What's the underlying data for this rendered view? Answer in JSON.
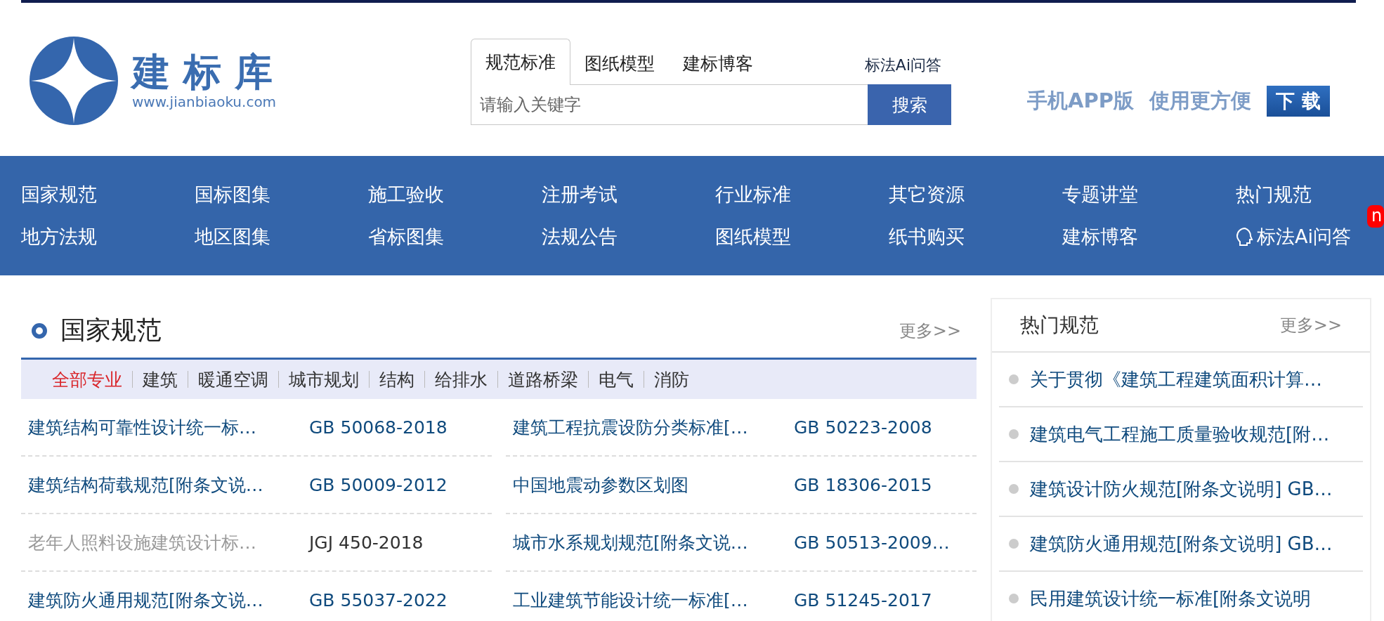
{
  "logo": {
    "name": "建 标 库",
    "url": "www.jianbiaoku.com"
  },
  "search": {
    "tabs": [
      {
        "label": "规范标准",
        "selected": true
      },
      {
        "label": "图纸模型",
        "selected": false
      },
      {
        "label": "建标博客",
        "selected": false
      }
    ],
    "ai_link": "标法Ai问答",
    "placeholder": "请输入关键字",
    "button": "搜索"
  },
  "app_promo": {
    "texts": [
      "手机APP版",
      "使用更方便"
    ],
    "button": "下 载"
  },
  "nav": {
    "items": [
      {
        "label": "国家规范",
        "kind": "link"
      },
      {
        "label": "国标图集",
        "kind": "link"
      },
      {
        "label": "施工验收",
        "kind": "link"
      },
      {
        "label": "注册考试",
        "kind": "link"
      },
      {
        "label": "行业标准",
        "kind": "link"
      },
      {
        "label": "其它资源",
        "kind": "link"
      },
      {
        "label": "专题讲堂",
        "kind": "link"
      },
      {
        "label": "热门规范",
        "kind": "link"
      },
      {
        "label": "地方法规",
        "kind": "link"
      },
      {
        "label": "地区图集",
        "kind": "link"
      },
      {
        "label": "省标图集",
        "kind": "link"
      },
      {
        "label": "法规公告",
        "kind": "link"
      },
      {
        "label": "图纸模型",
        "kind": "link"
      },
      {
        "label": "纸书购买",
        "kind": "link"
      },
      {
        "label": "建标博客",
        "kind": "link"
      },
      {
        "label": "标法Ai问答",
        "kind": "ai"
      }
    ],
    "badge": "n"
  },
  "section": {
    "title": "国家规范",
    "more": "更多>>",
    "filters": [
      {
        "label": "全部专业",
        "selected": true
      },
      {
        "label": "建筑",
        "selected": false
      },
      {
        "label": "暖通空调",
        "selected": false
      },
      {
        "label": "城市规划",
        "selected": false
      },
      {
        "label": "结构",
        "selected": false
      },
      {
        "label": "给排水",
        "selected": false
      },
      {
        "label": "道路桥梁",
        "selected": false
      },
      {
        "label": "电气",
        "selected": false
      },
      {
        "label": "消防",
        "selected": false
      }
    ],
    "rows": [
      {
        "title": "建筑结构可靠性设计统一标…",
        "code": "GB 50068-2018",
        "visited": false
      },
      {
        "title": "建筑工程抗震设防分类标准[…",
        "code": "GB 50223-2008",
        "visited": false
      },
      {
        "title": "建筑结构荷载规范[附条文说…",
        "code": "GB 50009-2012",
        "visited": false
      },
      {
        "title": "中国地震动参数区划图",
        "code": "GB 18306-2015",
        "visited": false
      },
      {
        "title": "老年人照料设施建筑设计标…",
        "code": "JGJ 450-2018",
        "visited": true
      },
      {
        "title": "城市水系规划规范[附条文说…",
        "code": "GB 50513-2009…",
        "visited": false
      },
      {
        "title": "建筑防火通用规范[附条文说…",
        "code": "GB 55037-2022",
        "visited": false
      },
      {
        "title": "工业建筑节能设计统一标准[…",
        "code": "GB 51245-2017",
        "visited": false
      }
    ]
  },
  "sidebar": {
    "title": "热门规范",
    "more": "更多>>",
    "items": [
      "关于贯彻《建筑工程建筑面积计算…",
      "建筑电气工程施工质量验收规范[附…",
      "建筑设计防火规范[附条文说明] GB…",
      "建筑防火通用规范[附条文说明] GB…",
      "民用建筑设计统一标准[附条文说明"
    ]
  }
}
